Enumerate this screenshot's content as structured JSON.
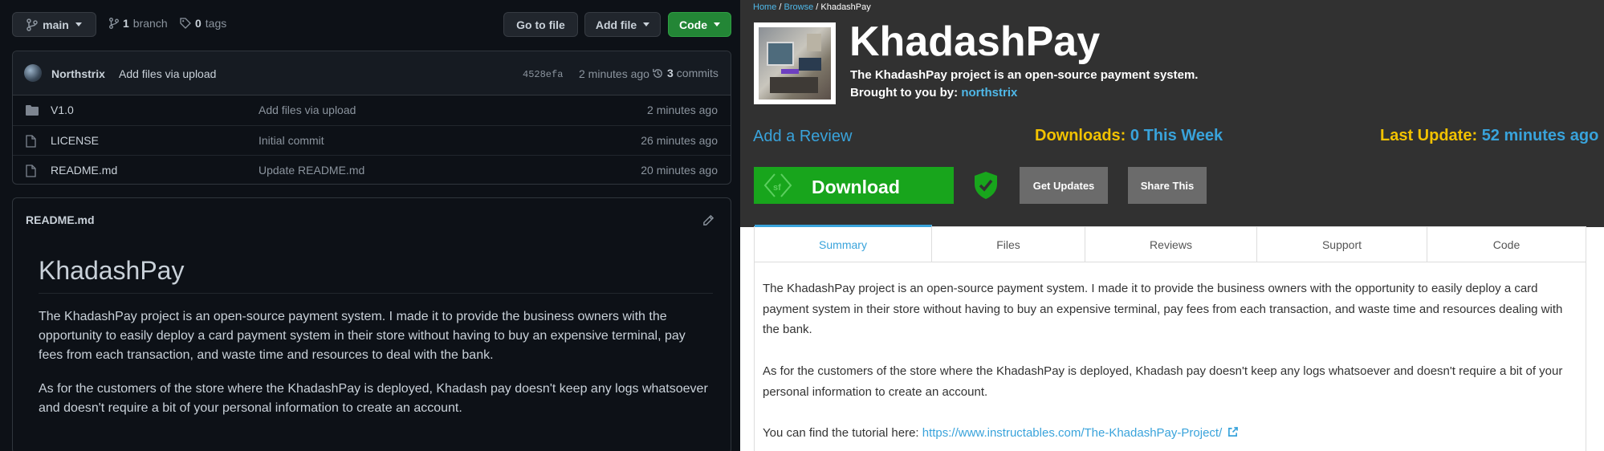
{
  "github": {
    "branch_button": "main",
    "branch_count": "1",
    "branch_label": "branch",
    "tag_count": "0",
    "tag_label": "tags",
    "go_to_file": "Go to file",
    "add_file": "Add file",
    "code": "Code",
    "commit": {
      "author": "Northstrix",
      "message": "Add files via upload",
      "hash": "4528efa",
      "age": "2 minutes ago",
      "commit_count": "3",
      "commit_label": "commits"
    },
    "files": [
      {
        "name": "V1.0",
        "type": "folder",
        "message": "Add files via upload",
        "age": "2 minutes ago"
      },
      {
        "name": "LICENSE",
        "type": "file",
        "message": "Initial commit",
        "age": "26 minutes ago"
      },
      {
        "name": "README.md",
        "type": "file",
        "message": "Update README.md",
        "age": "20 minutes ago"
      }
    ],
    "readme": {
      "filename": "README.md",
      "heading": "KhadashPay",
      "para1": "The KhadashPay project is an open-source payment system. I made it to provide the business owners with the opportunity to easily deploy a card payment system in their store without having to buy an expensive terminal, pay fees from each transaction, and waste time and resources to deal with the bank.",
      "para2": "As for the customers of the store where the KhadashPay is deployed, Khadash pay doesn't keep any logs whatsoever and doesn't require a bit of your personal information to create an account."
    }
  },
  "sourceforge": {
    "breadcrumb": {
      "home": "Home",
      "browse": "Browse",
      "current": "KhadashPay",
      "sep": " / "
    },
    "title": "KhadashPay",
    "tagline": "The KhadashPay project is an open-source payment system.",
    "brought_by_label": "Brought to you by:",
    "brought_by_user": "northstrix",
    "add_review": "Add a Review",
    "downloads_label": "Downloads:",
    "downloads_value": "0 This Week",
    "last_update_label": "Last Update:",
    "last_update_value": "52 minutes ago",
    "download_button": "Download",
    "get_updates": "Get Updates",
    "share_this": "Share This",
    "tabs": [
      "Summary",
      "Files",
      "Reviews",
      "Support",
      "Code"
    ],
    "summary": {
      "para1": "The KhadashPay project is an open-source payment system. I made it to provide the business owners with the opportunity to easily deploy a card payment system in their store without having to buy an expensive terminal, pay fees from each transaction, and waste time and resources dealing with the bank.",
      "para2": "As for the customers of the store where the KhadashPay is deployed, Khadash pay doesn't keep any logs whatsoever and doesn't require a bit of your personal information to create an account.",
      "tutorial_prefix": "You can find the tutorial here: ",
      "tutorial_link": "https://www.instructables.com/The-KhadashPay-Project/"
    }
  },
  "colors": {
    "gh_bg": "#0d1117",
    "gh_green": "#238636",
    "sf_header": "#313131",
    "sf_green": "#18a51c",
    "sf_yellow": "#f2c200",
    "sf_blue": "#39a3db"
  }
}
